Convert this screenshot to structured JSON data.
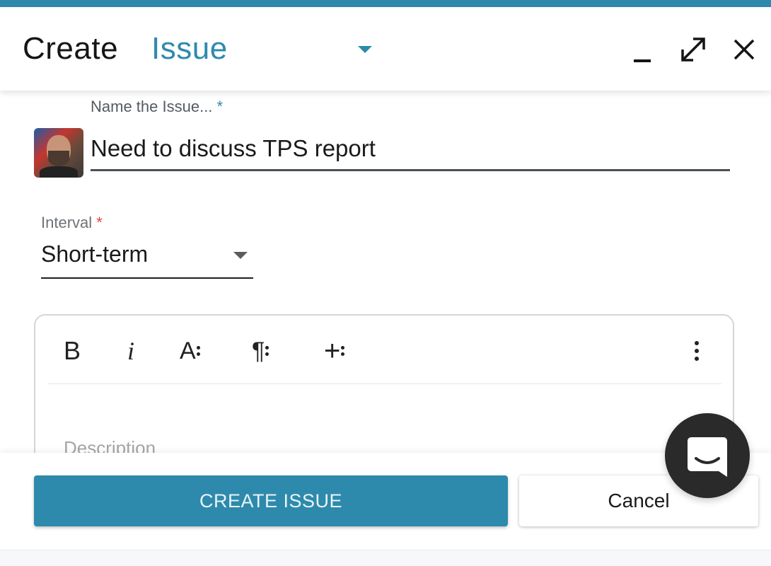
{
  "header": {
    "title_prefix": "Create",
    "item_type": "Issue"
  },
  "form": {
    "name_label": "Name the Issue...",
    "name_required_mark": "*",
    "name_value": "Need to discuss TPS report",
    "interval_label": "Interval",
    "interval_required_mark": "*",
    "interval_value": "Short-term"
  },
  "editor": {
    "toolbar": {
      "bold_label": "B",
      "italic_label": "i",
      "font_label": "A",
      "paragraph_label": "¶",
      "insert_label": "+"
    },
    "placeholder": "Description"
  },
  "footer": {
    "create_label": "CREATE ISSUE",
    "cancel_label": "Cancel"
  },
  "icons": {
    "minimize": "minimize-icon",
    "maximize": "expand-icon",
    "close": "close-icon",
    "type_dropdown": "chevron-down-icon",
    "interval_dropdown": "chevron-down-icon",
    "more": "vertical-dots-icon",
    "chat": "chat-icon"
  },
  "colors": {
    "accent": "#2e8aac",
    "required": "#e0453d",
    "chat_launcher": "#2a2a2a"
  }
}
